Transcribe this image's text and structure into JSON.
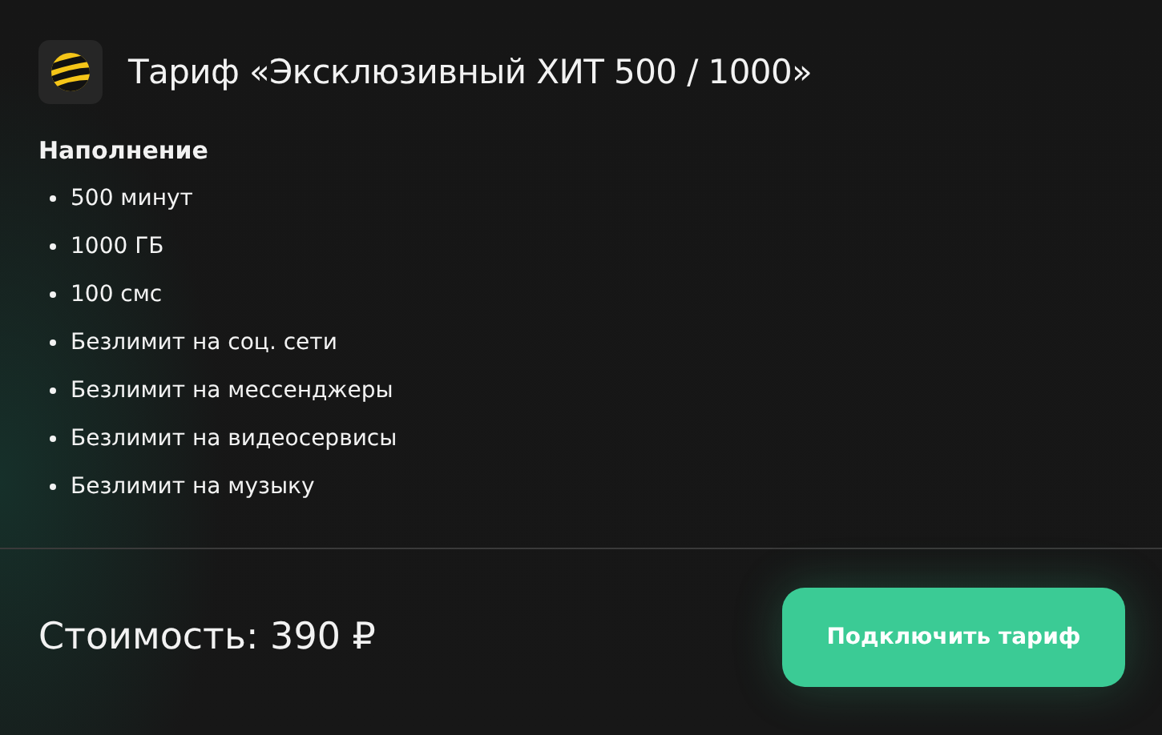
{
  "title": "Тариф «Эксклюзивный ХИТ 500 / 1000»",
  "section_title": "Наполнение",
  "features": [
    "500 минут",
    "1000 ГБ",
    "100 смс",
    "Безлимит на соц. сети",
    "Безлимит на мессенджеры",
    "Безлимит на видеосервисы",
    "Безлимит на музыку"
  ],
  "price": "Стоимость: 390 ₽",
  "button": "Подключить тариф"
}
